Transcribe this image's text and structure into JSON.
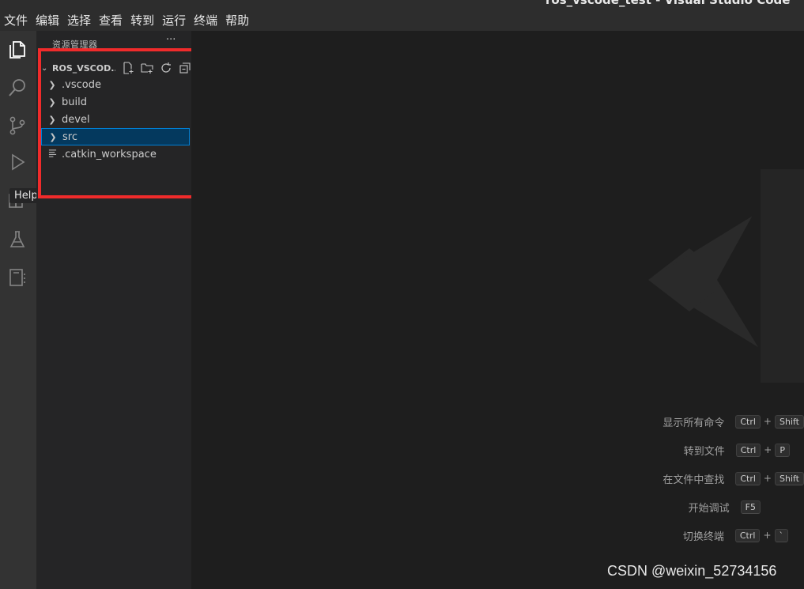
{
  "window_title": "ros_vscode_test - Visual Studio Code",
  "menu": [
    "文件",
    "编辑",
    "选择",
    "查看",
    "转到",
    "运行",
    "终端",
    "帮助"
  ],
  "activity_bar": {
    "icons": [
      "files-icon",
      "search-icon",
      "source-control-icon",
      "debug-icon",
      "extensions-icon",
      "testing-icon",
      "notebook-icon"
    ],
    "tooltip": "Help"
  },
  "explorer": {
    "title": "资源管理器",
    "more": "···",
    "workspace_name": "ROS_VSCOD...",
    "items": [
      {
        "label": ".vscode",
        "type": "folder",
        "selected": false
      },
      {
        "label": "build",
        "type": "folder",
        "selected": false
      },
      {
        "label": "devel",
        "type": "folder",
        "selected": false
      },
      {
        "label": "src",
        "type": "folder",
        "selected": true
      },
      {
        "label": ".catkin_workspace",
        "type": "file",
        "selected": false
      }
    ]
  },
  "shortcuts": [
    {
      "label": "显示所有命令",
      "keys": [
        "Ctrl",
        "Shift"
      ]
    },
    {
      "label": "转到文件",
      "keys": [
        "Ctrl",
        "P"
      ]
    },
    {
      "label": "在文件中查找",
      "keys": [
        "Ctrl",
        "Shift"
      ]
    },
    {
      "label": "开始调试",
      "keys": [
        "F5"
      ]
    },
    {
      "label": "切换终端",
      "keys": [
        "Ctrl",
        "`"
      ]
    }
  ],
  "watermark_text": "CSDN @weixin_52734156",
  "colors": {
    "highlight": "#f02b2b",
    "selection": "#04395e",
    "selection_border": "#007fd4"
  }
}
